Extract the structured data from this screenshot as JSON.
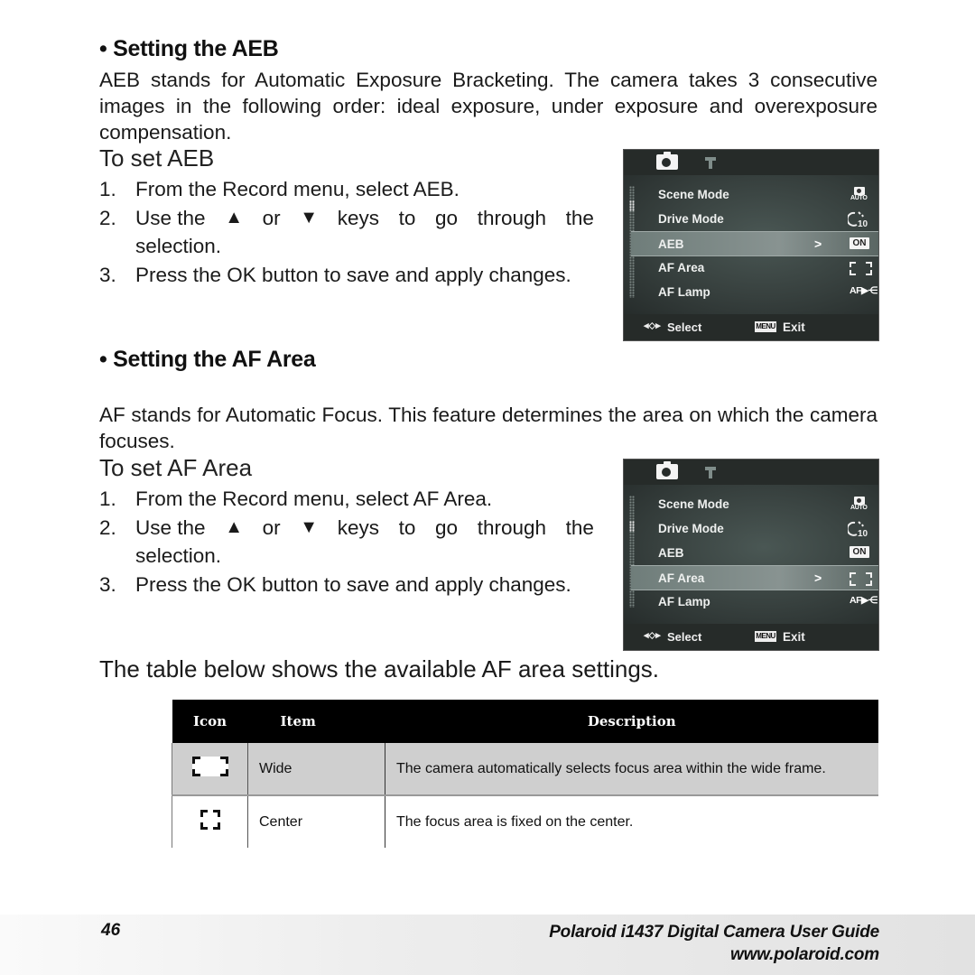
{
  "section_aeb": {
    "heading": "• Setting the AEB",
    "intro": "AEB stands for Automatic Exposure Bracketing. The camera takes 3 consecutive images in the following order: ideal exposure, under exposure and overexposure compensation.",
    "subheading": "To set AEB",
    "steps": [
      {
        "num": "1.",
        "pre": "From the Record menu, select AEB."
      },
      {
        "num": "2.",
        "pre": "Use the",
        "up": "▲",
        "or": "or",
        "down": "▼",
        "post": "keys to go through the selection."
      },
      {
        "num": "3.",
        "pre": "Press the OK button to save and apply changes."
      }
    ]
  },
  "section_af": {
    "heading": "• Setting the AF Area",
    "intro": "AF stands for Automatic Focus. This feature determines the area on which the camera focuses.",
    "subheading": "To set AF Area",
    "steps": [
      {
        "num": "1.",
        "pre": "From the Record menu, select AF Area."
      },
      {
        "num": "2.",
        "pre": "Use the",
        "up": "▲",
        "or": "or",
        "down": "▼",
        "post": "keys to go through the selection."
      },
      {
        "num": "3.",
        "pre": "Press the OK button to save and apply changes."
      }
    ],
    "table_intro": "The table below shows the available AF area settings."
  },
  "camera_menu": {
    "tabs": [
      {
        "icon": "camera-icon",
        "active": true
      },
      {
        "icon": "wrench-icon",
        "active": false
      }
    ],
    "items": [
      {
        "label": "Scene Mode",
        "value_icon": "auto-scene-icon",
        "value_text": "AUTO"
      },
      {
        "label": "Drive Mode",
        "value_icon": "self-timer-icon",
        "value_text": "10"
      },
      {
        "label": "AEB",
        "value_icon": "on-badge-icon",
        "value_text": "ON"
      },
      {
        "label": "AF Area",
        "value_icon": "af-wide-icon",
        "value_text": ""
      },
      {
        "label": "AF Lamp",
        "value_icon": "af-lamp-icon",
        "value_text": "AF"
      }
    ],
    "arrow": ">",
    "footer": {
      "select_label": "Select",
      "menu_badge": "MENU",
      "exit_label": "Exit"
    },
    "screens": [
      {
        "selected_item": "AEB"
      },
      {
        "selected_item": "AF Area"
      }
    ]
  },
  "af_table": {
    "headers": [
      "Icon",
      "Item",
      "Description"
    ],
    "rows": [
      {
        "icon": "af-wide-icon",
        "item": "Wide",
        "description": "The camera automatically selects focus area within the wide frame."
      },
      {
        "icon": "af-center-icon",
        "item": "Center",
        "description": "The focus area is fixed on the center."
      }
    ]
  },
  "footer": {
    "page_number": "46",
    "title": "Polaroid i1437 Digital Camera User Guide",
    "url": "www.polaroid.com"
  }
}
